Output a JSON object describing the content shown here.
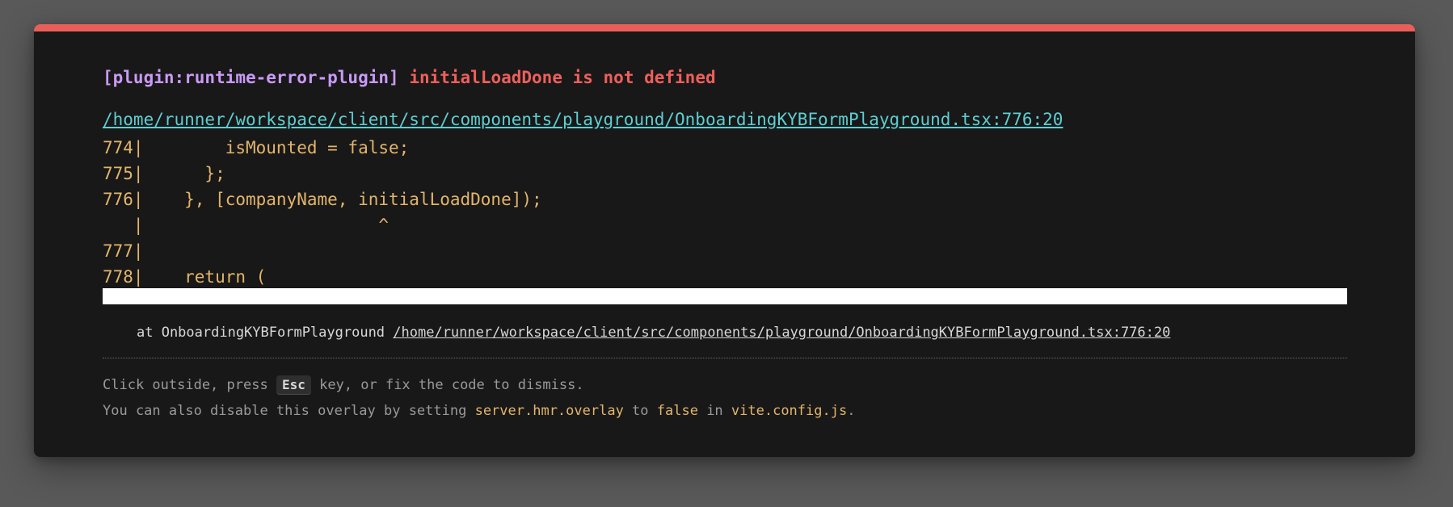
{
  "overlay": {
    "accent_color": "#e85f5a",
    "plugin_label": "[plugin:runtime-error-plugin]",
    "error_message": "initialLoadDone is not defined",
    "file_location": "/home/runner/workspace/client/src/components/playground/OnboardingKYBFormPlayground.tsx:776:20",
    "code_frame": [
      "774|        isMounted = false;",
      "775|      };",
      "776|    }, [companyName, initialLoadDone]);",
      "   |                       ^",
      "777|",
      "778|    return ("
    ],
    "stack": {
      "prefix": "at OnboardingKYBFormPlayground ",
      "link": "/home/runner/workspace/client/src/components/playground/OnboardingKYBFormPlayground.tsx:776:20"
    },
    "tip_line1": {
      "before": "Click outside, press ",
      "key": "Esc",
      "after": " key, or fix the code to dismiss."
    },
    "tip_line2": {
      "t1": "You can also disable this overlay by setting ",
      "c1": "server.hmr.overlay",
      "t2": " to ",
      "c2": "false",
      "t3": " in ",
      "c3": "vite.config.js",
      "t4": "."
    }
  }
}
